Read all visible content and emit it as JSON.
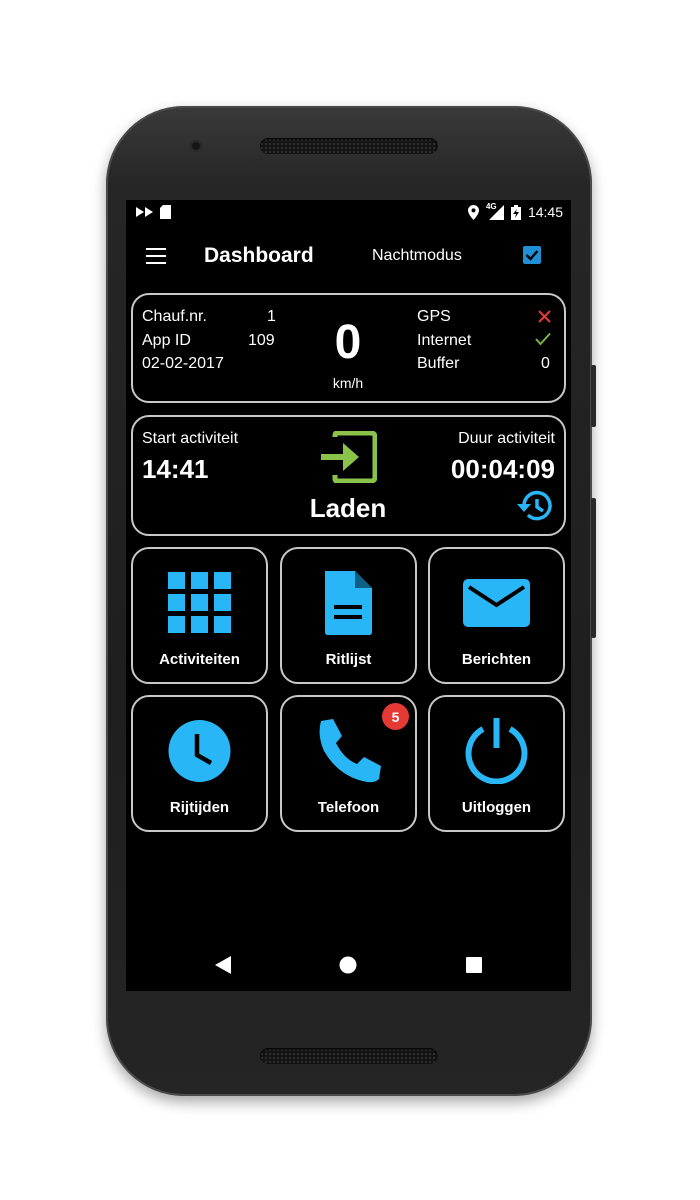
{
  "status_bar": {
    "time": "14:45",
    "network": "4G",
    "icons": [
      "media-forward-icon",
      "sd-card-icon",
      "location-icon",
      "signal-icon",
      "battery-icon"
    ]
  },
  "app_bar": {
    "title": "Dashboard",
    "night_mode_label": "Nachtmodus",
    "night_mode_checked": true
  },
  "info_card": {
    "driver_label": "Chauf.nr.",
    "driver_value": "1",
    "app_id_label": "App ID",
    "app_id_value": "109",
    "date": "02-02-2017",
    "speed": "0",
    "speed_unit": "km/h",
    "gps_label": "GPS",
    "gps_status": "error",
    "internet_label": "Internet",
    "internet_status": "ok",
    "buffer_label": "Buffer",
    "buffer_value": "0"
  },
  "activity_card": {
    "start_label": "Start activiteit",
    "start_time": "14:41",
    "duration_label": "Duur activiteit",
    "duration": "00:04:09",
    "activity_name": "Laden",
    "activity_icon": "login-arrow-icon",
    "history_icon": "history-icon"
  },
  "tiles": [
    {
      "label": "Activiteiten",
      "icon": "grid-icon"
    },
    {
      "label": "Ritlijst",
      "icon": "document-icon"
    },
    {
      "label": "Berichten",
      "icon": "mail-icon"
    },
    {
      "label": "Rijtijden",
      "icon": "clock-icon"
    },
    {
      "label": "Telefoon",
      "icon": "phone-icon",
      "badge": "5"
    },
    {
      "label": "Uitloggen",
      "icon": "power-icon"
    }
  ],
  "colors": {
    "accent_blue": "#29b6f6",
    "activity_green": "#8bc34a",
    "error_red": "#e53935",
    "ok_green": "#7cb342",
    "checkbox_blue": "#1f8fd6"
  }
}
